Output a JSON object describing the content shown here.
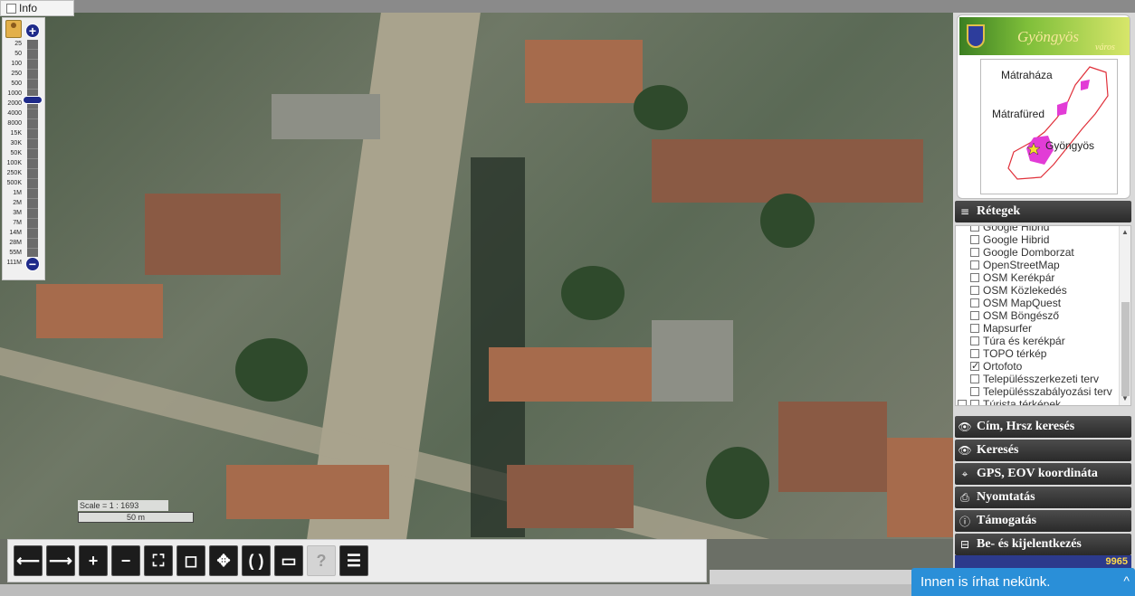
{
  "info_toggle": {
    "label": "Info",
    "checked": false
  },
  "zoom": {
    "scale_labels": [
      "25",
      "50",
      "100",
      "250",
      "500",
      "1000",
      "2000",
      "4000",
      "8000",
      "15K",
      "30K",
      "50K",
      "100K",
      "250K",
      "500K",
      "1M",
      "2M",
      "3M",
      "7M",
      "14M",
      "28M",
      "55M",
      "111M"
    ],
    "plus": "+",
    "minus": "−"
  },
  "scale": {
    "ratio_text": "Scale = 1 : 1693",
    "bar_text": "50 m"
  },
  "toolbar": {
    "icons": [
      "arrow-left-icon",
      "arrow-right-icon",
      "zoom-in-icon",
      "zoom-out-icon",
      "zoom-box-icon",
      "zoom-extent-icon",
      "pan-icon",
      "rotate-icon",
      "measure-icon",
      "help-icon",
      "document-icon"
    ],
    "glyphs": [
      "⟵",
      "⟶",
      "+",
      "−",
      "⛶",
      "◻",
      "✥",
      "( )",
      "▭",
      "?",
      "☰"
    ],
    "disabled": [
      "help-icon"
    ]
  },
  "logo": {
    "title": "Gyöngyös",
    "subtitle": "város"
  },
  "minimap": {
    "labels": [
      "Mátraháza",
      "Mátrafüred",
      "Gyöngyös"
    ]
  },
  "layers": {
    "header": "Rétegek",
    "items": [
      {
        "label": "Google Hibrid",
        "checked": false
      },
      {
        "label": "Google Hibrid",
        "checked": false
      },
      {
        "label": "Google Domborzat",
        "checked": false
      },
      {
        "label": "OpenStreetMap",
        "checked": false
      },
      {
        "label": "OSM Kerékpár",
        "checked": false
      },
      {
        "label": "OSM Közlekedés",
        "checked": false
      },
      {
        "label": "OSM MapQuest",
        "checked": false
      },
      {
        "label": "OSM Böngésző",
        "checked": false
      },
      {
        "label": "Mapsurfer",
        "checked": false
      },
      {
        "label": "Túra és kerékpár",
        "checked": false
      },
      {
        "label": "TOPO térkép",
        "checked": false
      },
      {
        "label": "Ortofoto",
        "checked": true
      },
      {
        "label": "Településszerkezeti terv",
        "checked": false
      },
      {
        "label": "Településszabályozási terv",
        "checked": false
      },
      {
        "label": "Túrista térképek",
        "checked": false,
        "group": true
      }
    ]
  },
  "menu": [
    {
      "label": "Cím, Hrsz keresés",
      "icon": "eye-icon",
      "glyph": "👁"
    },
    {
      "label": "Keresés",
      "icon": "eye-icon",
      "glyph": "👁"
    },
    {
      "label": "GPS, EOV koordináta",
      "icon": "crosshair-icon",
      "glyph": "⌖"
    },
    {
      "label": "Nyomtatás",
      "icon": "printer-icon",
      "glyph": "⎙"
    },
    {
      "label": "Támogatás",
      "icon": "info-icon",
      "glyph": "ⓘ"
    },
    {
      "label": "Be- és kijelentkezés",
      "icon": "login-icon",
      "glyph": "⊟"
    }
  ],
  "counter": "9965",
  "chat": {
    "label": "Innen is írhat nekünk.",
    "chevron": "^"
  }
}
